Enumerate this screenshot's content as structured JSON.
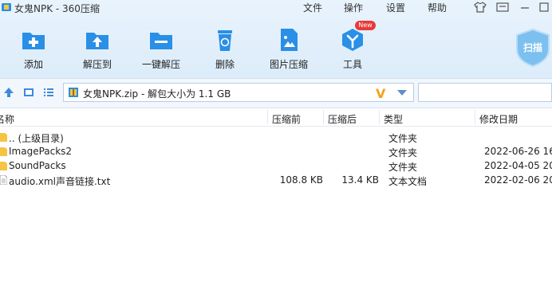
{
  "window": {
    "title": "女鬼NPK - 360压缩",
    "menus": [
      "文件",
      "操作",
      "设置",
      "帮助"
    ]
  },
  "toolbar": {
    "items": [
      {
        "label": "添加",
        "icon": "add-icon"
      },
      {
        "label": "解压到",
        "icon": "extract-to-icon"
      },
      {
        "label": "一键解压",
        "icon": "one-click-extract-icon"
      },
      {
        "label": "删除",
        "icon": "recycle-bin-icon"
      },
      {
        "label": "图片压缩",
        "icon": "image-compress-icon"
      },
      {
        "label": "工具",
        "icon": "tools-cube-icon"
      }
    ],
    "new_badge": "New",
    "scan_label": "扫描"
  },
  "address": {
    "path": "女鬼NPK.zip - 解包大小为 1.1 GB",
    "v_mark": "V",
    "search_value": ""
  },
  "columns": {
    "name": "名称",
    "packed": "压缩前",
    "compressed": "压缩后",
    "type": "类型",
    "modified": "修改日期"
  },
  "files": [
    {
      "name": ".. (上级目录)",
      "packed": "",
      "compressed": "",
      "type": "文件夹",
      "modified": "",
      "kind": "folder"
    },
    {
      "name": "ImagePacks2",
      "packed": "",
      "compressed": "",
      "type": "文件夹",
      "modified": "2022-06-26 16",
      "kind": "folder"
    },
    {
      "name": "SoundPacks",
      "packed": "",
      "compressed": "",
      "type": "文件夹",
      "modified": "2022-04-05 20",
      "kind": "folder"
    },
    {
      "name": "audio.xml声音链接.txt",
      "packed": "108.8 KB",
      "compressed": "13.4 KB",
      "type": "文本文档",
      "modified": "2022-02-06 20",
      "kind": "text"
    }
  ],
  "colors": {
    "toolbar_blue": "#2a8fe6",
    "folder_yellow": "#f5c542",
    "badge_red": "#e83a3a"
  }
}
